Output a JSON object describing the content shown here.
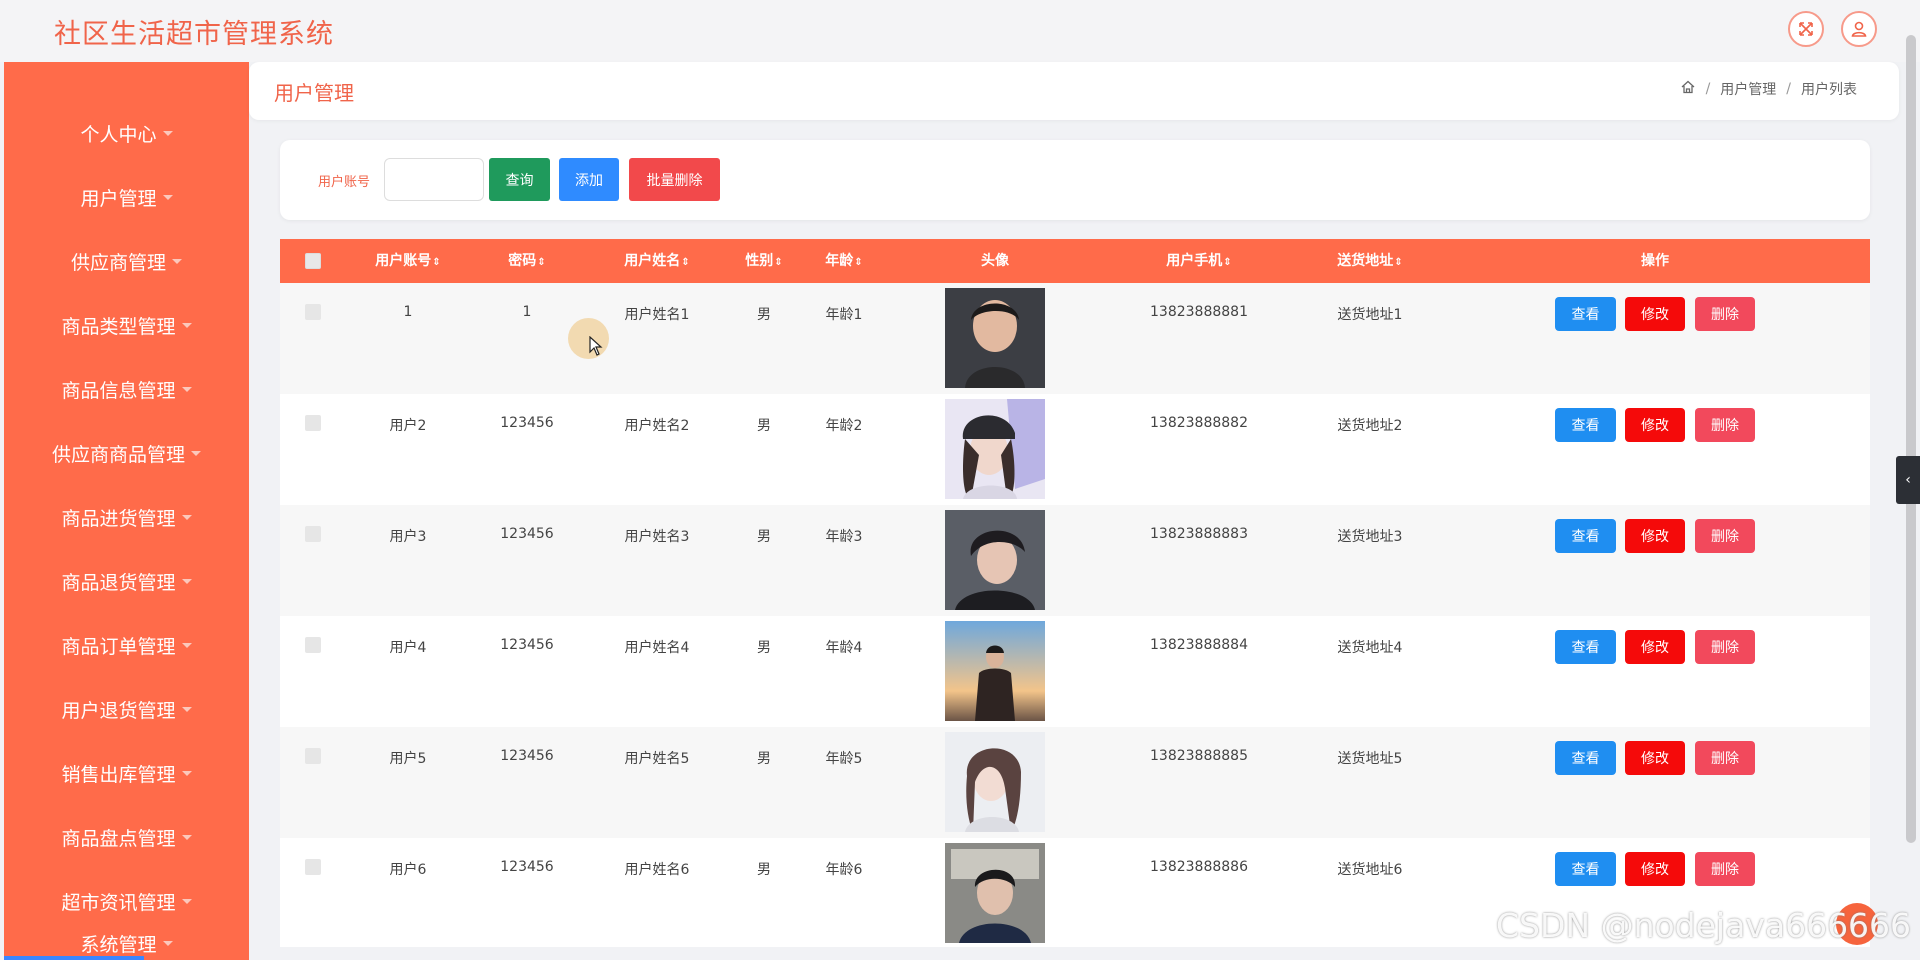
{
  "app": {
    "title": "社区生活超市管理系统"
  },
  "top_icons": {
    "fullscreen": "fullscreen-icon",
    "user": "user-icon"
  },
  "sidebar": {
    "items": [
      {
        "label": "个人中心"
      },
      {
        "label": "用户管理"
      },
      {
        "label": "供应商管理"
      },
      {
        "label": "商品类型管理"
      },
      {
        "label": "商品信息管理"
      },
      {
        "label": "供应商商品管理"
      },
      {
        "label": "商品进货管理"
      },
      {
        "label": "商品退货管理"
      },
      {
        "label": "商品订单管理"
      },
      {
        "label": "用户退货管理"
      },
      {
        "label": "销售出库管理"
      },
      {
        "label": "商品盘点管理"
      },
      {
        "label": "超市资讯管理"
      },
      {
        "label": "系统管理"
      }
    ]
  },
  "header": {
    "title": "用户管理",
    "breadcrumb": [
      "用户管理",
      "用户列表"
    ]
  },
  "search": {
    "label": "用户账号",
    "value": "",
    "query_label": "查询",
    "add_label": "添加",
    "bulk_delete_label": "批量删除"
  },
  "table": {
    "columns": {
      "account": "用户账号",
      "password": "密码",
      "name": "用户姓名",
      "gender": "性别",
      "age": "年龄",
      "avatar": "头像",
      "phone": "用户手机",
      "address": "送货地址",
      "actions": "操作"
    },
    "action_labels": {
      "view": "查看",
      "edit": "修改",
      "delete": "删除"
    },
    "rows": [
      {
        "account": "1",
        "password": "1",
        "name": "用户姓名1",
        "gender": "男",
        "age": "年龄1",
        "phone": "13823888881",
        "address": "送货地址1"
      },
      {
        "account": "用户2",
        "password": "123456",
        "name": "用户姓名2",
        "gender": "男",
        "age": "年龄2",
        "phone": "13823888882",
        "address": "送货地址2"
      },
      {
        "account": "用户3",
        "password": "123456",
        "name": "用户姓名3",
        "gender": "男",
        "age": "年龄3",
        "phone": "13823888883",
        "address": "送货地址3"
      },
      {
        "account": "用户4",
        "password": "123456",
        "name": "用户姓名4",
        "gender": "男",
        "age": "年龄4",
        "phone": "13823888884",
        "address": "送货地址4"
      },
      {
        "account": "用户5",
        "password": "123456",
        "name": "用户姓名5",
        "gender": "男",
        "age": "年龄5",
        "phone": "13823888885",
        "address": "送货地址5"
      },
      {
        "account": "用户6",
        "password": "123456",
        "name": "用户姓名6",
        "gender": "男",
        "age": "年龄6",
        "phone": "13823888886",
        "address": "送货地址6"
      }
    ]
  },
  "watermark": "CSDN @nodejava666666",
  "colors": {
    "accent": "#ff6b4a",
    "title": "#f0644a",
    "query": "#1f9a5c",
    "add": "#2f8bff",
    "bulk_delete": "#f2494b",
    "view": "#1f8ef1",
    "edit": "#f50a0a",
    "delete": "#f2495c"
  }
}
